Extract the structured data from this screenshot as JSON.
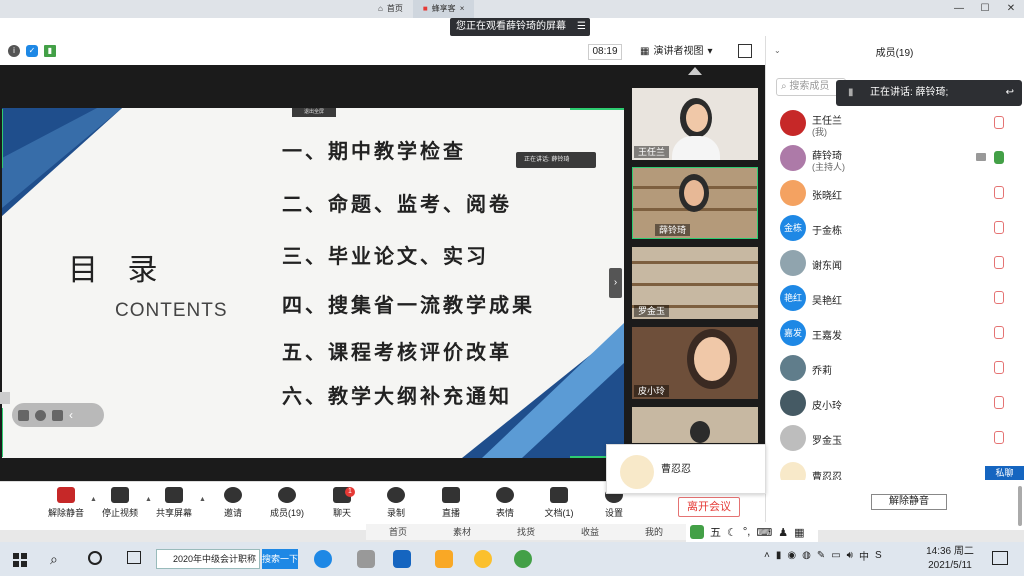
{
  "browser_tabs": [
    {
      "label": "首页"
    },
    {
      "label": "蜂享客"
    }
  ],
  "banner": "您正在观看薛铃琦的屏幕",
  "zoom_header": {
    "time": "08:19",
    "view_mode": "演讲者视图"
  },
  "slide": {
    "title": "目 录",
    "subtitle": "CONTENTS",
    "items": [
      "一、期中教学检查",
      "二、命题、监考、阅卷",
      "三、毕业论文、实习",
      "四、搜集省一流教学成果",
      "五、课程考核评价改革",
      "六、教学大纲补充通知"
    ],
    "speaking_tag": "正在讲话: 薛铃琦",
    "share_tag": "退出全屏"
  },
  "thumbnails": [
    {
      "name": "王任兰"
    },
    {
      "name": "薛铃琦"
    },
    {
      "name": "罗金玉"
    },
    {
      "name": "皮小玲"
    }
  ],
  "toolbar": {
    "mute": "解除静音",
    "video": "停止视频",
    "share": "共享屏幕",
    "invite": "邀请",
    "members": "成员(19)",
    "chat": "聊天",
    "chat_badge": "1",
    "record": "录制",
    "live": "直播",
    "reactions": "表情",
    "docs": "文档(1)",
    "settings": "设置",
    "leave": "离开会议"
  },
  "members": {
    "title": "成员(19)",
    "search_placeholder": "搜索成员",
    "speaking": "正在讲话: 薛铃琦;",
    "list": [
      {
        "name": "王任兰",
        "sub": "(我)",
        "avatar": "",
        "color": "#c62828"
      },
      {
        "name": "薛铃琦",
        "sub": "(主持人)",
        "avatar": "",
        "color": "#ad7aa8"
      },
      {
        "name": "张晓红",
        "sub": "",
        "avatar": "",
        "color": "#f4a261"
      },
      {
        "name": "于金栋",
        "sub": "",
        "avatar": "金栋",
        "color": "#1e88e5"
      },
      {
        "name": "谢东闻",
        "sub": "",
        "avatar": "",
        "color": "#90a4ae"
      },
      {
        "name": "吴艳红",
        "sub": "",
        "avatar": "艳红",
        "color": "#1e88e5"
      },
      {
        "name": "王嘉发",
        "sub": "",
        "avatar": "嘉发",
        "color": "#1e88e5"
      },
      {
        "name": "乔莉",
        "sub": "",
        "avatar": "",
        "color": "#607d8b"
      },
      {
        "name": "皮小玲",
        "sub": "",
        "avatar": "",
        "color": "#455a64"
      },
      {
        "name": "罗金玉",
        "sub": "",
        "avatar": "",
        "color": "#bdbdbd"
      },
      {
        "name": "曹忍忍",
        "sub": "",
        "avatar": "",
        "color": "#f8e9c9"
      }
    ],
    "private_btn": "私聊",
    "unmute_all": "解除静音"
  },
  "popup": {
    "name": "曹忍忍"
  },
  "subnav": [
    "首页",
    "素材",
    "找货",
    "收益",
    "我的"
  ],
  "ime": {
    "label": "五"
  },
  "taskbar": {
    "search_box": "2020年中级会计职称",
    "search_btn": "搜索一下",
    "time": "14:36 周二",
    "date": "2021/5/11"
  }
}
